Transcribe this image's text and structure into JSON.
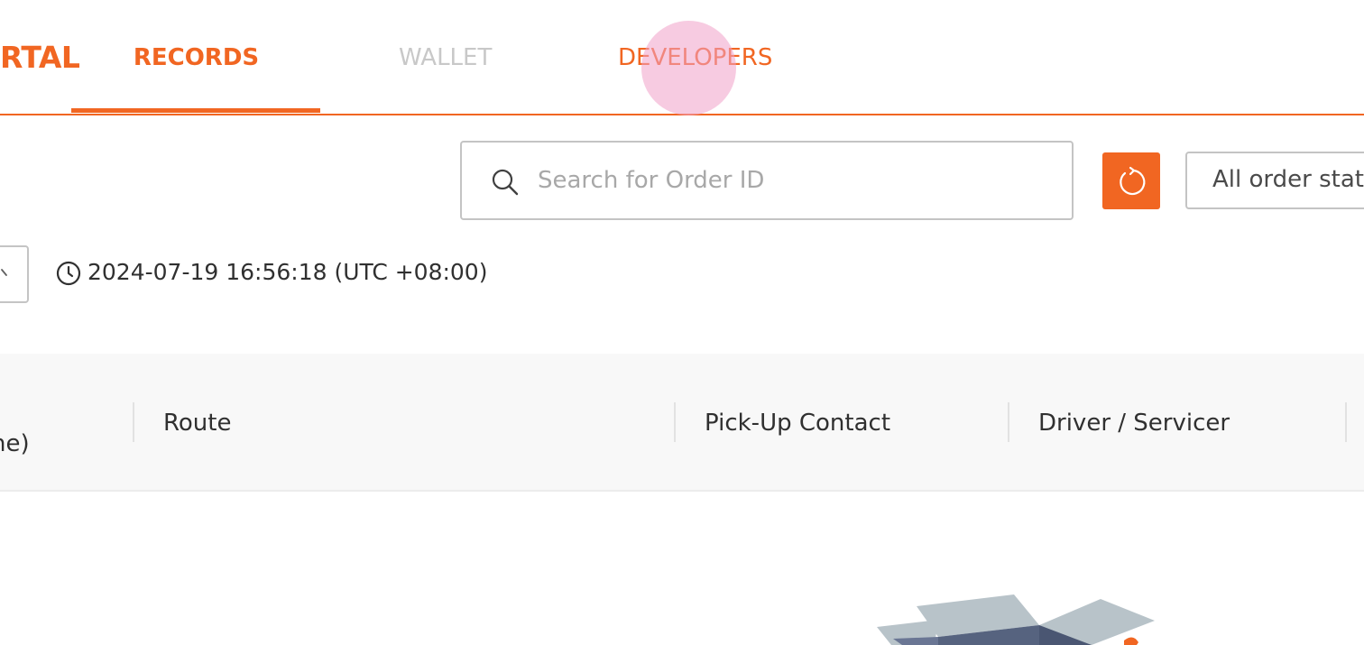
{
  "nav": {
    "brand_fragment": "RTAL",
    "tabs": [
      {
        "label": "RECORDS",
        "active": true
      },
      {
        "label": "WALLET",
        "active": false
      },
      {
        "label": "DEVELOPERS",
        "active": false
      }
    ]
  },
  "toolbar": {
    "search_placeholder": "Search for Order ID",
    "status_filter": "All order stat",
    "timestamp": "2024-07-19 16:56:18 (UTC +08:00)"
  },
  "table": {
    "partial_column": "ne)",
    "columns": [
      "Route",
      "Pick-Up Contact",
      "Driver / Servicer"
    ]
  },
  "colors": {
    "accent": "#f16622",
    "inactive_tab": "#c8c8c8",
    "header_bg": "#f8f8f8"
  },
  "icons": {
    "search": "search-icon",
    "refresh": "refresh-icon",
    "clock": "clock-icon",
    "dropdown": "chevron-down-icon"
  }
}
